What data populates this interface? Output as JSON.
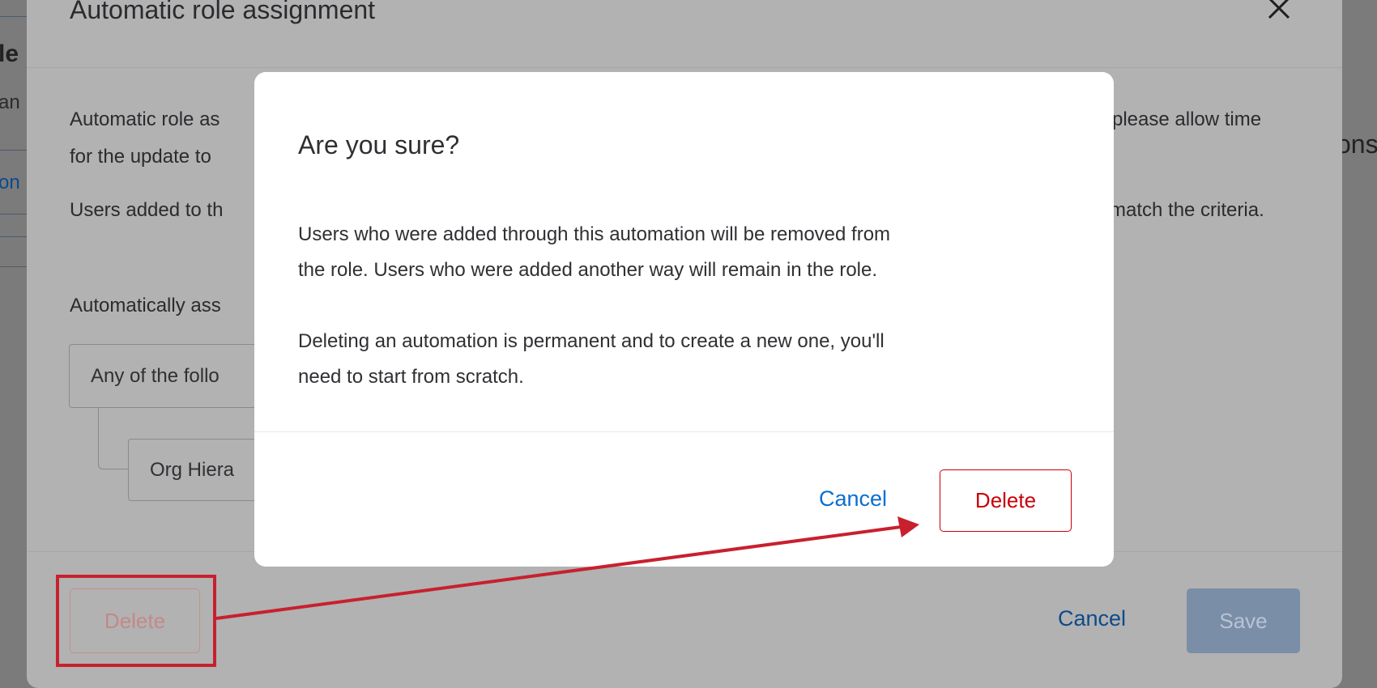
{
  "background_page": {
    "left_fragments": [
      "le",
      "an",
      "on"
    ],
    "right_fragment": "ons"
  },
  "outer_modal": {
    "title": "Automatic role assignment",
    "close_icon": "close-icon",
    "body_line1_left": "Automatic role as",
    "body_line1_right": "please allow time",
    "body_line2_left": "for the update to",
    "body_line3_left": "Users added to th",
    "body_line3_right": "match the criteria.",
    "assign_label": "Automatically ass",
    "condition_group": "Any of the follo",
    "condition_item": "Org Hiera",
    "delete_label": "Delete",
    "cancel_label": "Cancel",
    "save_label": "Save"
  },
  "confirm_dialog": {
    "title": "Are you sure?",
    "paragraph1_line1": "Users who were added through this automation will be removed from",
    "paragraph1_line2": "the role. Users who were added another way will remain in the role.",
    "paragraph2_line1": "Deleting an automation is permanent and to create a new one, you'll",
    "paragraph2_line2": "need to start from scratch.",
    "cancel_label": "Cancel",
    "delete_label": "Delete"
  },
  "annotation": {
    "color": "#c8202f"
  },
  "colors": {
    "link_blue": "#0b6ed0",
    "danger_red": "#c8000a"
  }
}
